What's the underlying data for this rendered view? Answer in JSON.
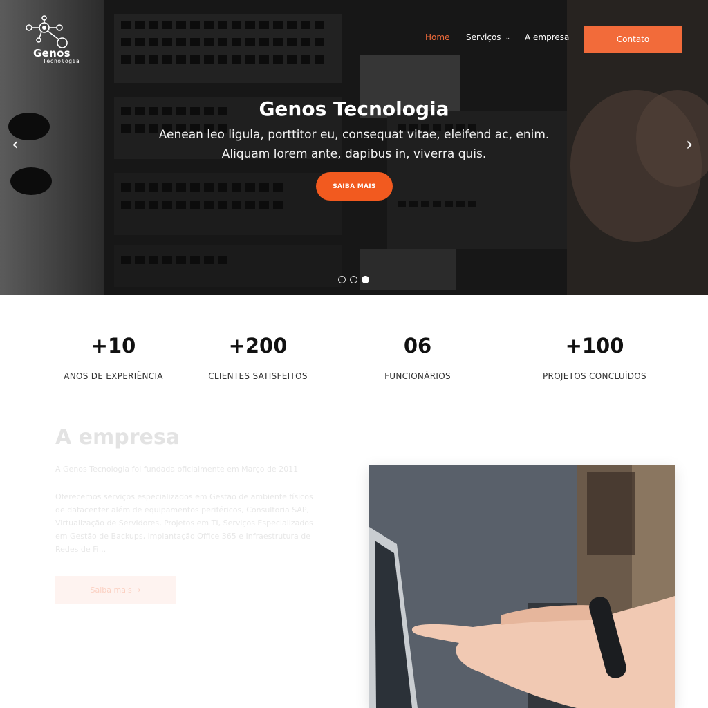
{
  "brand": {
    "name": "Genos",
    "sub": "Tecnologia"
  },
  "nav": {
    "items": [
      {
        "label": "Home",
        "active": true
      },
      {
        "label": "Serviços",
        "dropdown": true
      },
      {
        "label": "A empresa"
      }
    ],
    "cta": "Contato"
  },
  "hero": {
    "title": "Genos Tecnologia",
    "subtitle": "Aenean leo ligula, porttitor eu, consequat vitae, eleifend ac, enim. Aliquam lorem ante, dapibus in, viverra quis.",
    "button": "SAIBA MAIS",
    "prev": "‹",
    "next": "›",
    "slides": 3,
    "active_slide": 3
  },
  "stats": [
    {
      "value": "+10",
      "label": "ANOS DE EXPERIÊNCIA"
    },
    {
      "value": "+200",
      "label": "CLIENTES SATISFEITOS"
    },
    {
      "value": "06",
      "label": "FUNCIONÁRIOS"
    },
    {
      "value": "+100",
      "label": "PROJETOS CONCLUÍDOS"
    }
  ],
  "about": {
    "title": "A empresa",
    "p1": "A Genos Tecnologia foi fundada oficialmente em Março de 2011",
    "p2": "Oferecemos serviços especializados em Gestão de ambiente físicos de datacenter além de equipamentos periféricos, Consultoria SAP, Virtualização de Servidores, Projetos em TI, Serviços Especializados em Gestão de Backups, implantação Office 365 e Infraestrutura de Redes de Fi...",
    "button": "Saiba mais →"
  },
  "colors": {
    "accent": "#f26b3a",
    "button": "#f25a1f"
  }
}
